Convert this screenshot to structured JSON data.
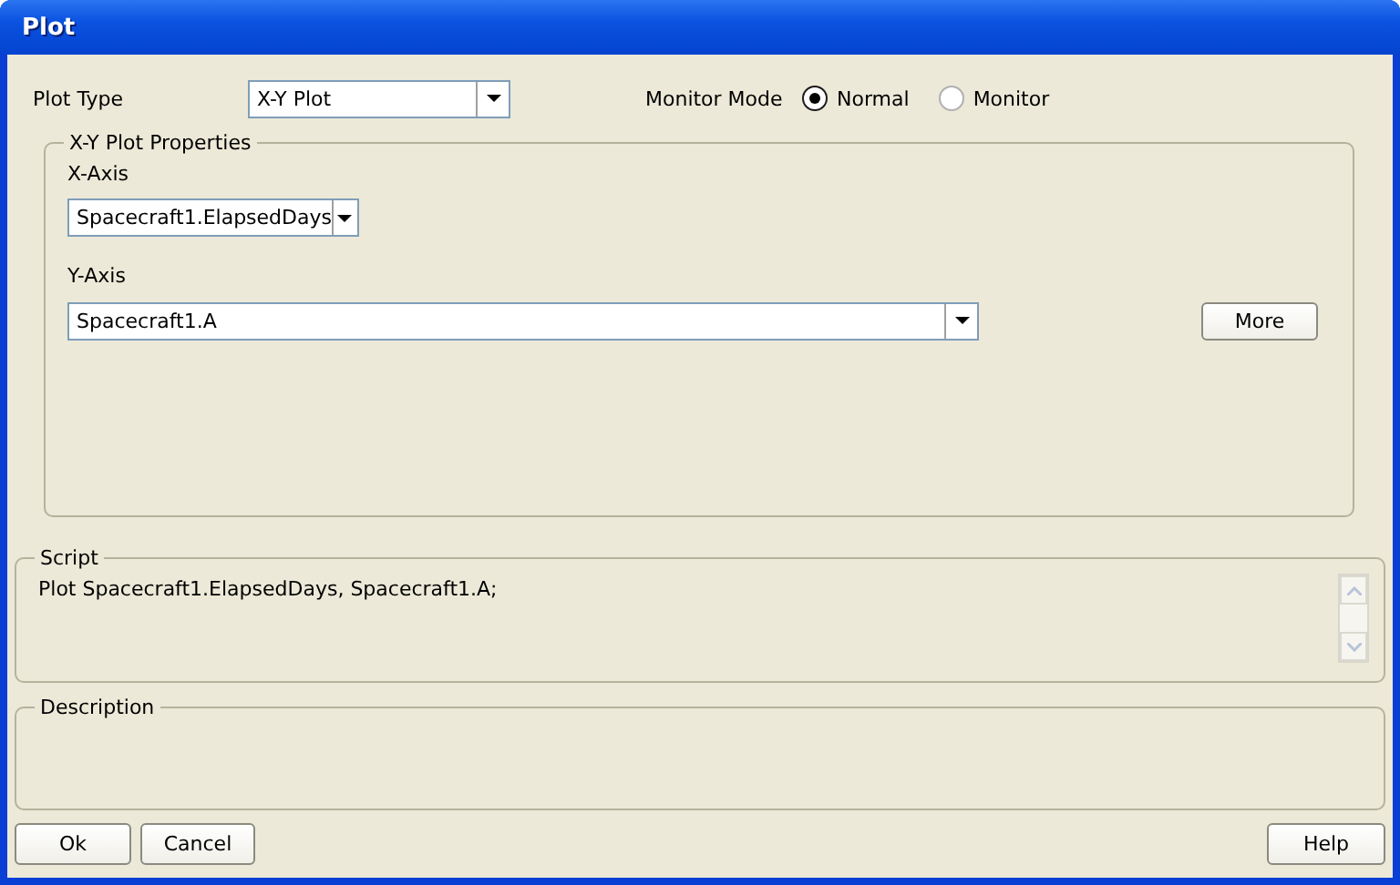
{
  "window": {
    "title": "Plot"
  },
  "plot_type": {
    "label": "Plot Type",
    "value": "X-Y Plot"
  },
  "monitor_mode": {
    "label": "Monitor Mode",
    "options": [
      {
        "label": "Normal",
        "selected": true
      },
      {
        "label": "Monitor",
        "selected": false
      }
    ]
  },
  "properties": {
    "title": "X-Y Plot Properties",
    "x_axis": {
      "label": "X-Axis",
      "value": "Spacecraft1.ElapsedDays"
    },
    "y_axis": {
      "label": "Y-Axis",
      "value": "Spacecraft1.A"
    },
    "more_button": "More"
  },
  "script": {
    "title": "Script",
    "text": "Plot Spacecraft1.ElapsedDays, Spacecraft1.A;"
  },
  "description": {
    "title": "Description"
  },
  "left_buttons": [
    "Ok",
    "Cancel"
  ],
  "right_buttons": [
    "Help"
  ]
}
